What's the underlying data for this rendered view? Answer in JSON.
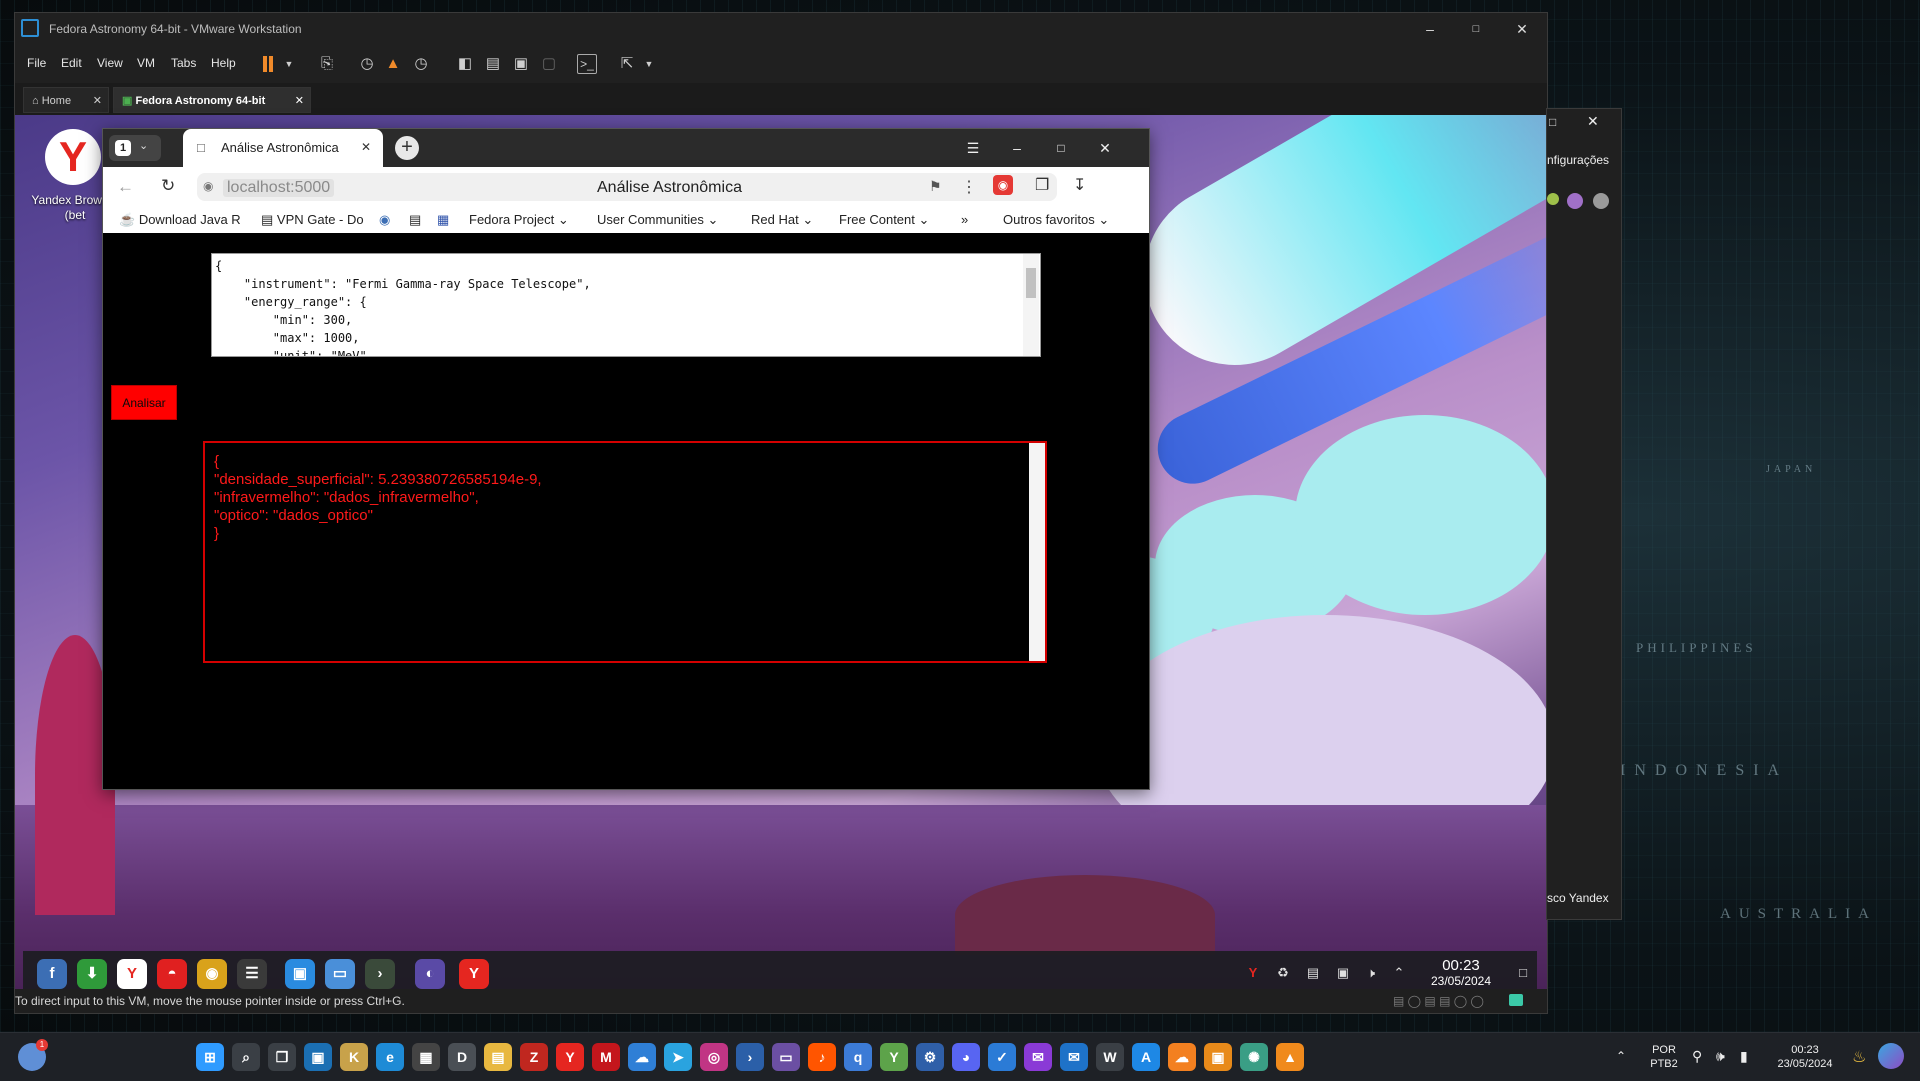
{
  "host": {
    "map_labels": [
      "PHILIPPINES",
      "INDONESIA",
      "AUSTRALIA",
      "JAPAN"
    ],
    "clock_time": "00:23",
    "clock_date": "23/05/2024",
    "lang_top": "POR",
    "lang_bottom": "PTB2",
    "notif_badge": "1",
    "taskbar_icons": [
      {
        "name": "windows-start-icon",
        "glyph": "⊞",
        "color": "#2f9bff"
      },
      {
        "name": "search-icon",
        "glyph": "⌕",
        "color": "#3a3f45"
      },
      {
        "name": "task-view-icon",
        "glyph": "❐",
        "color": "#3a3f45"
      },
      {
        "name": "vmware-workstation-icon",
        "glyph": "▣",
        "color": "#1b6fb3"
      },
      {
        "name": "app-k-icon",
        "glyph": "K",
        "color": "#c8a24a"
      },
      {
        "name": "edge-icon",
        "glyph": "e",
        "color": "#1e8bd6"
      },
      {
        "name": "store-icon",
        "glyph": "▦",
        "color": "#444"
      },
      {
        "name": "dell-icon",
        "glyph": "D",
        "color": "#4a4f55"
      },
      {
        "name": "file-explorer-icon",
        "glyph": "▤",
        "color": "#e8b840"
      },
      {
        "name": "filezilla-icon",
        "glyph": "Z",
        "color": "#c0271f"
      },
      {
        "name": "yandex-icon",
        "glyph": "Y",
        "color": "#e52620"
      },
      {
        "name": "mcafee-icon",
        "glyph": "M",
        "color": "#c4161c"
      },
      {
        "name": "cloud-app-icon",
        "glyph": "☁",
        "color": "#2f7fd6"
      },
      {
        "name": "telegram-icon",
        "glyph": "➤",
        "color": "#2aa3df"
      },
      {
        "name": "instagram-icon",
        "glyph": "◎",
        "color": "#c13584"
      },
      {
        "name": "powershell-icon",
        "glyph": "›",
        "color": "#2b5fa8"
      },
      {
        "name": "terminal-app-icon",
        "glyph": "▭",
        "color": "#6b4fa3"
      },
      {
        "name": "soundcloud-icon",
        "glyph": "♪",
        "color": "#ff5500"
      },
      {
        "name": "qbittorrent-icon",
        "glyph": "q",
        "color": "#3c7bd6"
      },
      {
        "name": "app-y-icon",
        "glyph": "Y",
        "color": "#5da34a"
      },
      {
        "name": "app-tools-icon",
        "glyph": "⚙",
        "color": "#2f5fa8"
      },
      {
        "name": "discord-icon",
        "glyph": "◕",
        "color": "#5865f2"
      },
      {
        "name": "todo-icon",
        "glyph": "✓",
        "color": "#2b7bd6"
      },
      {
        "name": "messenger-icon",
        "glyph": "✉",
        "color": "#8a3ad6"
      },
      {
        "name": "mail-icon",
        "glyph": "✉",
        "color": "#1e72c8"
      },
      {
        "name": "wordpress-icon",
        "glyph": "W",
        "color": "#3a3f45"
      },
      {
        "name": "app-a-icon",
        "glyph": "A",
        "color": "#1e88e5"
      },
      {
        "name": "cloudflare-icon",
        "glyph": "☁",
        "color": "#f38020"
      },
      {
        "name": "vmware-icon",
        "glyph": "▣",
        "color": "#e88a1a"
      },
      {
        "name": "chatgpt-icon",
        "glyph": "✺",
        "color": "#3a9e85"
      },
      {
        "name": "vlc-icon",
        "glyph": "▲",
        "color": "#f08a1c"
      }
    ]
  },
  "vmware": {
    "title": "Fedora Astronomy 64-bit - VMware Workstation",
    "menu": [
      "File",
      "Edit",
      "View",
      "VM",
      "Tabs",
      "Help"
    ],
    "tabs": [
      {
        "label": "Home"
      },
      {
        "label": "Fedora Astronomy 64-bit"
      }
    ],
    "status_text": "To direct input to this VM, move the mouse pointer inside or press Ctrl+G.",
    "side_panel": {
      "text_config": "nfigurações",
      "text_yandex": "sco Yandex"
    }
  },
  "guest": {
    "desktop_icon_label": "Yandex Browser (bet",
    "desktop_icon_glyph": "Y",
    "clock_time": "00:23",
    "clock_date": "23/05/2024",
    "taskbar_icons": [
      {
        "name": "fedora-icon",
        "glyph": "f",
        "color": "#3c6eb4"
      },
      {
        "name": "download-manager-icon",
        "glyph": "⬇",
        "color": "#2f9a3a"
      },
      {
        "name": "yandex-icon",
        "glyph": "Y",
        "color": "#ffffff"
      },
      {
        "name": "redhat-icon",
        "glyph": "◓",
        "color": "#e02020"
      },
      {
        "name": "gold-disc-icon",
        "glyph": "◉",
        "color": "#d9a21b"
      },
      {
        "name": "settings-sliders-icon",
        "glyph": "☰",
        "color": "#3a3a3a"
      },
      {
        "name": "software-center-icon",
        "glyph": "▣",
        "color": "#2a8be0"
      },
      {
        "name": "files-icon",
        "glyph": "▭",
        "color": "#4a8fd9"
      },
      {
        "name": "terminal-icon",
        "glyph": "›",
        "color": "#3a4a3a"
      },
      {
        "name": "stellarium-icon",
        "glyph": "◐",
        "color": "#5a4aa6"
      },
      {
        "name": "yandex-browser-icon",
        "glyph": "Y",
        "color": "#e52620"
      }
    ]
  },
  "browser": {
    "tab_count": "1",
    "tab_title": "Análise Astronômica",
    "url": "localhost:5000",
    "page_title": "Análise Astronômica",
    "bookmarks": [
      {
        "label": "Download Java R",
        "icon": "java-icon"
      },
      {
        "label": "VPN Gate - Do",
        "icon": "document-icon"
      },
      {
        "label": "",
        "icon": "fedora-icon"
      },
      {
        "label": "",
        "icon": "document-icon"
      },
      {
        "label": "",
        "icon": "bookmark-app-icon"
      },
      {
        "label": "Fedora Project",
        "icon": "folder"
      },
      {
        "label": "User Communities",
        "icon": "folder"
      },
      {
        "label": "Red Hat",
        "icon": "folder"
      },
      {
        "label": "Free Content",
        "icon": "folder"
      },
      {
        "label": "»",
        "icon": "overflow"
      },
      {
        "label": "Outros favoritos",
        "icon": "folder"
      }
    ],
    "json_input": "{\n    \"instrument\": \"Fermi Gamma-ray Space Telescope\",\n    \"energy_range\": {\n        \"min\": 300,\n        \"max\": 1000,\n        \"unit\": \"MeV\"",
    "analyze_label": "Analisar",
    "result_text": "{\n\"densidade_superficial\": 5.239380726585194e-9,\n\"infravermelho\": \"dados_infravermelho\",\n\"optico\": \"dados_optico\"\n}"
  },
  "colors": {
    "analyze_button": "#ff0000",
    "result_text": "#ff1a1a",
    "result_border": "#d40000"
  }
}
